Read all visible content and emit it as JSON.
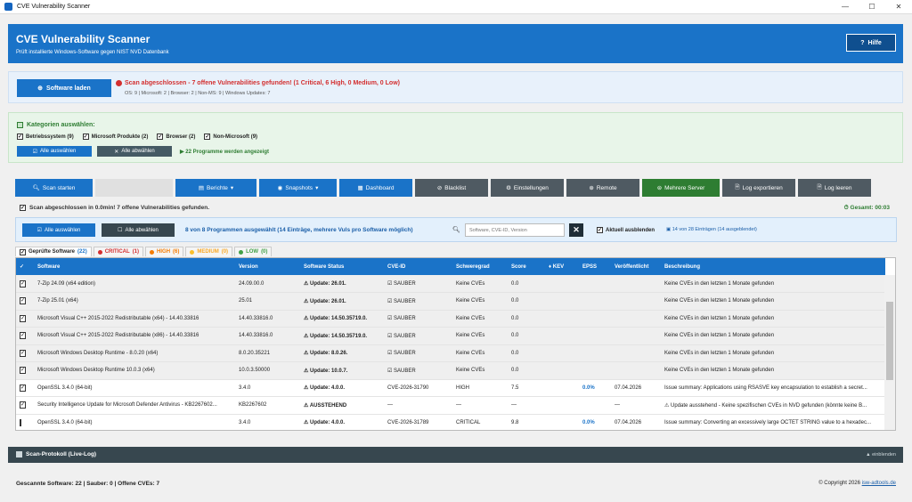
{
  "window": {
    "title": "CVE Vulnerability Scanner"
  },
  "header": {
    "title": "CVE Vulnerability Scanner",
    "subtitle": "Prüft installierte Windows-Software gegen NIST NVD Datenbank",
    "help_label": "Hilfe"
  },
  "load": {
    "button_label": "Software laden",
    "status": "Scan abgeschlossen - 7 offene Vulnerabilities gefunden! (1 Critical, 6 High, 0 Medium, 0 Low)",
    "counts": "OS: 9 | Microsoft: 2 | Browser: 2 | Non-MS: 9 | Windows Updates: 7"
  },
  "categories": {
    "title": "Kategorien auswählen:",
    "items": [
      {
        "label": "Betriebssystem (9)",
        "checked": true
      },
      {
        "label": "Microsoft Produkte (2)",
        "checked": true
      },
      {
        "label": "Browser (2)",
        "checked": true
      },
      {
        "label": "Non-Microsoft (9)",
        "checked": true
      }
    ],
    "select_all": "Alle auswählen",
    "deselect_all": "Alle abwählen",
    "info": "22 Programme werden angezeigt"
  },
  "toolbar": {
    "scan": "Scan starten",
    "reports": "Berichte",
    "snapshots": "Snapshots",
    "dashboard": "Dashboard",
    "blacklist": "Blacklist",
    "settings": "Einstellungen",
    "remote": "Remote",
    "multi_server": "Mehrere Server",
    "log_export": "Log exportieren",
    "log_clear": "Log leeren"
  },
  "status_line": "Scan abgeschlossen in 0.0min! 7 offene Vulnerabilities gefunden.",
  "total_time": "Gesamt: 00:03",
  "selection": {
    "select_all": "Alle auswählen",
    "deselect_all": "Alle abwählen",
    "info": "8 von 8 Programmen ausgewählt (14 Einträge, mehrere Vuls pro Software möglich)",
    "search_placeholder": "Software, CVE-ID, Version",
    "hide_current": "Aktuell ausblenden",
    "entry_count": "14 von 28 Einträgen (14 ausgeblendet)"
  },
  "tabs": [
    {
      "label": "Geprüfte Software",
      "count": "(22)",
      "color": "#1a73c8"
    },
    {
      "label": "CRITICAL",
      "count": "(1)",
      "color": "#d32f2f"
    },
    {
      "label": "HIGH",
      "count": "(6)",
      "color": "#f57c00"
    },
    {
      "label": "MEDIUM",
      "count": "(0)",
      "color": "#fbc02d"
    },
    {
      "label": "LOW",
      "count": "(0)",
      "color": "#43a047"
    }
  ],
  "table": {
    "columns": [
      "✓",
      "Software",
      "Version",
      "Software Status",
      "CVE-ID",
      "Schweregrad",
      "Score",
      "KEV",
      "EPSS",
      "Veröffentlicht",
      "Beschreibung"
    ],
    "rows": [
      {
        "checked": true,
        "software": "7-Zip 24.09 (x64 edition)",
        "version": "24.09.00.0",
        "status": "⚠ Update: 26.01.",
        "cve": "☑ SAUBER",
        "severity": "Keine CVEs",
        "score": "0.0",
        "kev": "",
        "epss": "",
        "published": "",
        "desc": "Keine CVEs in den letzten 1 Monate gefunden"
      },
      {
        "checked": true,
        "software": "7-Zip 25.01 (x64)",
        "version": "25.01",
        "status": "⚠ Update: 26.01.",
        "cve": "☑ SAUBER",
        "severity": "Keine CVEs",
        "score": "0.0",
        "kev": "",
        "epss": "",
        "published": "",
        "desc": "Keine CVEs in den letzten 1 Monate gefunden"
      },
      {
        "checked": true,
        "software": "Microsoft Visual C++ 2015-2022 Redistributable (x64) - 14.40.33816",
        "version": "14.40.33816.0",
        "status": "⚠ Update: 14.50.35719.0.",
        "cve": "☑ SAUBER",
        "severity": "Keine CVEs",
        "score": "0.0",
        "kev": "",
        "epss": "",
        "published": "",
        "desc": "Keine CVEs in den letzten 1 Monate gefunden"
      },
      {
        "checked": true,
        "software": "Microsoft Visual C++ 2015-2022 Redistributable (x86) - 14.40.33816",
        "version": "14.40.33816.0",
        "status": "⚠ Update: 14.50.35719.0.",
        "cve": "☑ SAUBER",
        "severity": "Keine CVEs",
        "score": "0.0",
        "kev": "",
        "epss": "",
        "published": "",
        "desc": "Keine CVEs in den letzten 1 Monate gefunden"
      },
      {
        "checked": true,
        "software": "Microsoft Windows Desktop Runtime - 8.0.20 (x64)",
        "version": "8.0.20.35221",
        "status": "⚠ Update: 8.0.26.",
        "cve": "☑ SAUBER",
        "severity": "Keine CVEs",
        "score": "0.0",
        "kev": "",
        "epss": "",
        "published": "",
        "desc": "Keine CVEs in den letzten 1 Monate gefunden"
      },
      {
        "checked": true,
        "software": "Microsoft Windows Desktop Runtime 10.0.3 (x64)",
        "version": "10.0.3.50000",
        "status": "⚠ Update: 10.0.7.",
        "cve": "☑ SAUBER",
        "severity": "Keine CVEs",
        "score": "0.0",
        "kev": "",
        "epss": "",
        "published": "",
        "desc": "Keine CVEs in den letzten 1 Monate gefunden"
      },
      {
        "checked": true,
        "software": "OpenSSL 3.4.0 (64-bit)",
        "version": "3.4.0",
        "status": "⚠ Update: 4.0.0.",
        "cve": "CVE-2026-31790",
        "severity": "HIGH",
        "score": "7.5",
        "kev": "",
        "epss": "0.0%",
        "published": "07.04.2026",
        "desc": "Issue summary: Applications using RSASVE key encapsulation to establish a secret..."
      },
      {
        "checked": true,
        "software": "Security Intelligence Update for Microsoft Defender Antivirus - KB2267602...",
        "version": "KB2267602",
        "status": "⚠ AUSSTEHEND",
        "cve": "—",
        "severity": "—",
        "score": "—",
        "kev": "",
        "epss": "",
        "published": "—",
        "desc": "⚠ Update ausstehend - Keine spezifischen CVEs in NVD gefunden (könnte keine B..."
      },
      {
        "checked": false,
        "software": "OpenSSL 3.4.0 (64-bit)",
        "version": "3.4.0",
        "status": "⚠ Update: 4.0.0.",
        "cve": "CVE-2026-31789",
        "severity": "CRITICAL",
        "score": "9.8",
        "kev": "",
        "epss": "0.0%",
        "published": "07.04.2026",
        "desc": "Issue summary: Converting an excessively large OCTET STRING value to a hexadec..."
      }
    ]
  },
  "log": {
    "title": "Scan-Protokoll (Live-Log)",
    "expand": "einblenden"
  },
  "footer": {
    "stats": "Gescannte Software: 22 | Sauber: 0 | Offene CVEs: 7",
    "copyright": "© Copyright 2026",
    "link": "isw-adtools.de"
  }
}
